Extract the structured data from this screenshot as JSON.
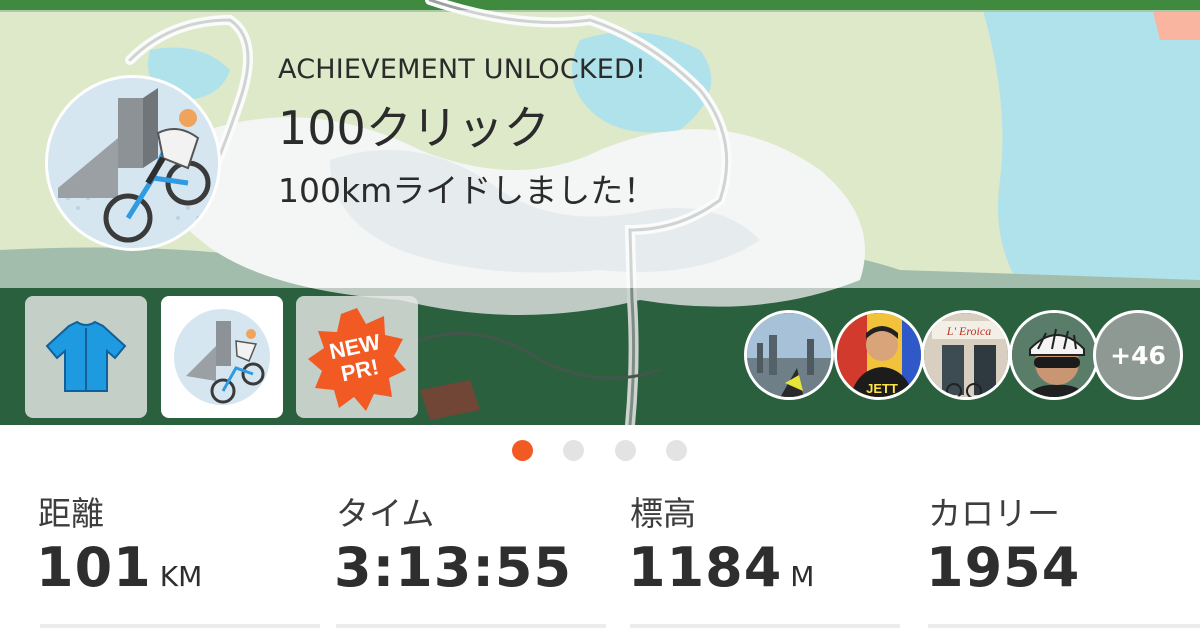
{
  "achievement": {
    "heading": "ACHIEVEMENT UNLOCKED!",
    "title": "100クリック",
    "description": "100kmライドしました！"
  },
  "thumbnails": [
    {
      "name": "jersey",
      "icon": "jersey-icon"
    },
    {
      "name": "achievement-badge",
      "icon": "cyclist-badge-icon"
    },
    {
      "name": "new-pr",
      "icon": "new-pr-badge-icon",
      "label": "NEW PR!"
    }
  ],
  "participants": {
    "avatars": [
      "avatar-city-view",
      "avatar-jett-rider",
      "avatar-shop-front",
      "avatar-helmet-rider"
    ],
    "shop_sign": "L' Eroica",
    "jersey_text": "JETT",
    "more_count": "+46"
  },
  "pager": {
    "pages": 4,
    "active": 1
  },
  "stats": {
    "distance": {
      "label": "距離",
      "value": "101",
      "unit": "KM"
    },
    "time": {
      "label": "タイム",
      "value": "3:13:55"
    },
    "elevation": {
      "label": "標高",
      "value": "1184",
      "unit": "M"
    },
    "calories": {
      "label": "カロリー",
      "value": "1954"
    }
  },
  "colors": {
    "accent": "#f15a22",
    "text": "#2e2e2e",
    "jersey": "#1e9be0",
    "map_water": "#4fc3dc",
    "map_forest": "#2f6b43"
  }
}
